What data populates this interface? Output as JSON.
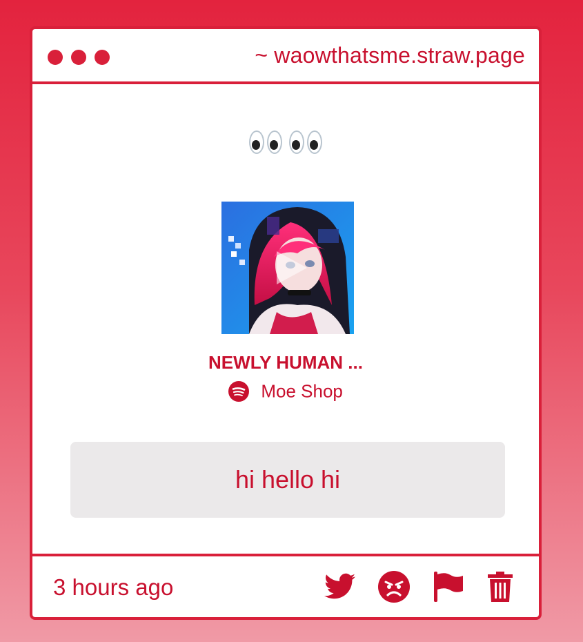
{
  "window": {
    "url": "~ waowthatsme.straw.page",
    "accent": "#d9203a"
  },
  "post": {
    "emoji_text": "👀👀",
    "track": {
      "title": "NEWLY HUMAN ...",
      "artist": "Moe Shop",
      "service_icon": "spotify-icon",
      "cover_icon": "play-icon"
    },
    "message": "hi hello hi"
  },
  "footer": {
    "timestamp": "3 hours ago",
    "actions": [
      "twitter-icon",
      "angry-face-icon",
      "flag-icon",
      "trash-icon"
    ]
  }
}
